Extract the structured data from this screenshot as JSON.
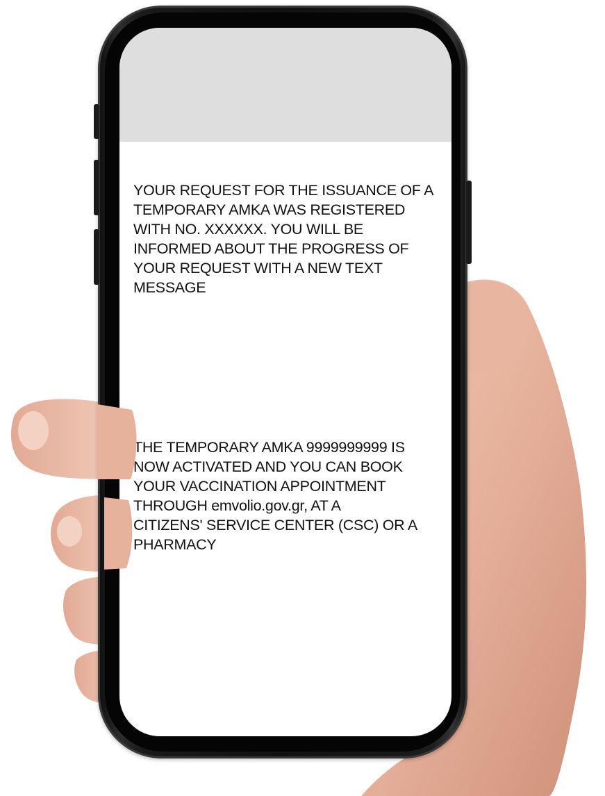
{
  "screen": {
    "messages": [
      {
        "text": "YOUR REQUEST FOR THE ISSUANCE OF A\nTEMPORARY AMKA WAS  REGISTERED\nWITH NO. XXXXXX. YOU WILL BE\nINFORMED ABOUT THE PROGRESS OF\nYOUR  REQUEST WITH A NEW TEXT\nMESSAGE"
      },
      {
        "text": "THE TEMPORARY AMKA 9999999999 IS\nNOW ACTIVATED AND YOU CAN BOOK\nYOUR VACCINATION APPOINTMENT\nTHROUGH emvolio.gov.gr, AT A\nCITIZENS' SERVICE CENTER (CSC) OR A\nPHARMACY"
      }
    ]
  },
  "colors": {
    "frame": "#111111",
    "status_area": "#dedede",
    "screen_background": "#ffffff",
    "text": "#111111",
    "skin": "#e9b9a3"
  }
}
